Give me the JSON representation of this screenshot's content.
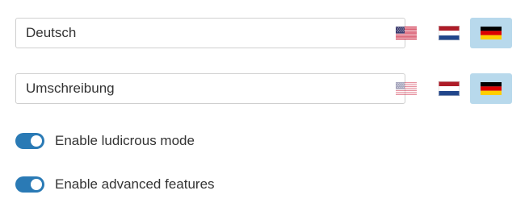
{
  "fields": [
    {
      "value": "Deutsch"
    },
    {
      "value": "Umschreibung"
    }
  ],
  "flags": {
    "us": {
      "icon": "us-flag-icon"
    },
    "nl": {
      "icon": "netherlands-flag-icon"
    },
    "de": {
      "icon": "germany-flag-icon",
      "selected_bg": "#b8d9ec"
    }
  },
  "toggles": [
    {
      "label": "Enable ludicrous mode",
      "checked": true
    },
    {
      "label": "Enable advanced features",
      "checked": true
    }
  ],
  "colors": {
    "toggle_on": "#2a7ab5",
    "selected_flag_bg": "#b8d9ec",
    "text": "#333333",
    "input_border": "#cfcfcf"
  }
}
